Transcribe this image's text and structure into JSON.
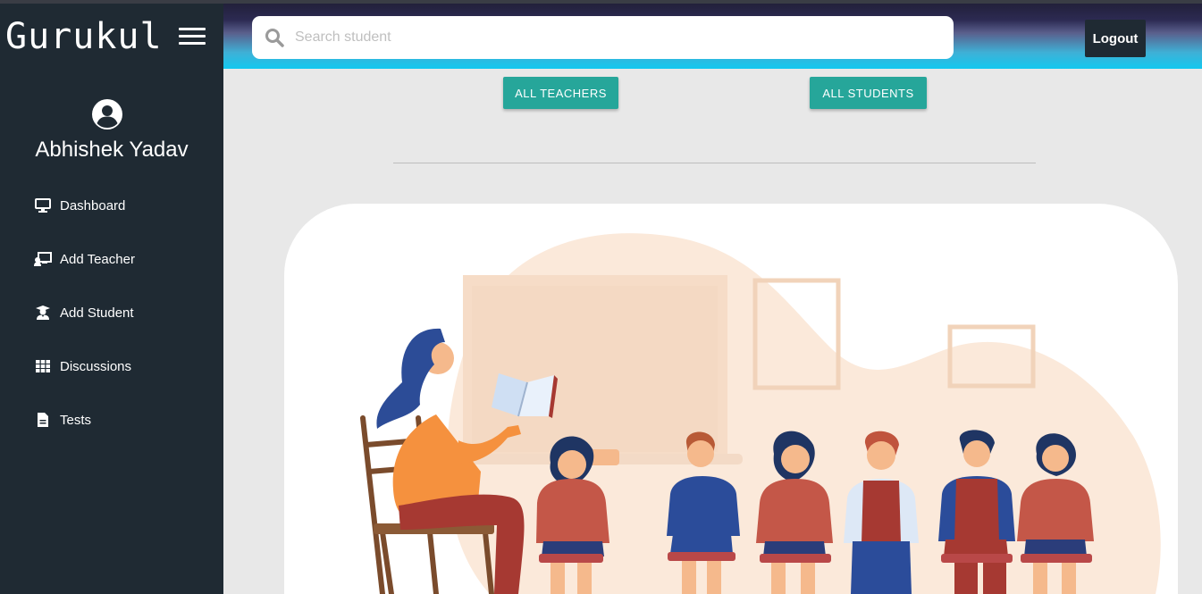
{
  "app": {
    "brand": "Gurukul"
  },
  "user": {
    "name": "Abhishek Yadav"
  },
  "sidebar": {
    "items": [
      {
        "label": "Dashboard",
        "icon": "monitor-icon"
      },
      {
        "label": "Add Teacher",
        "icon": "chalkboard-teacher-icon"
      },
      {
        "label": "Add Student",
        "icon": "user-graduate-icon"
      },
      {
        "label": "Discussions",
        "icon": "grid-icon"
      },
      {
        "label": "Tests",
        "icon": "file-icon"
      }
    ]
  },
  "header": {
    "search_placeholder": "Search student",
    "logout_label": "Logout"
  },
  "main": {
    "all_teachers_label": "ALL TEACHERS",
    "all_students_label": "ALL STUDENTS"
  },
  "colors": {
    "sidebar": "#1f2a33",
    "accent": "#26a69a",
    "header_gradient_top": "#22203a",
    "header_gradient_bottom": "#12c8ef"
  }
}
